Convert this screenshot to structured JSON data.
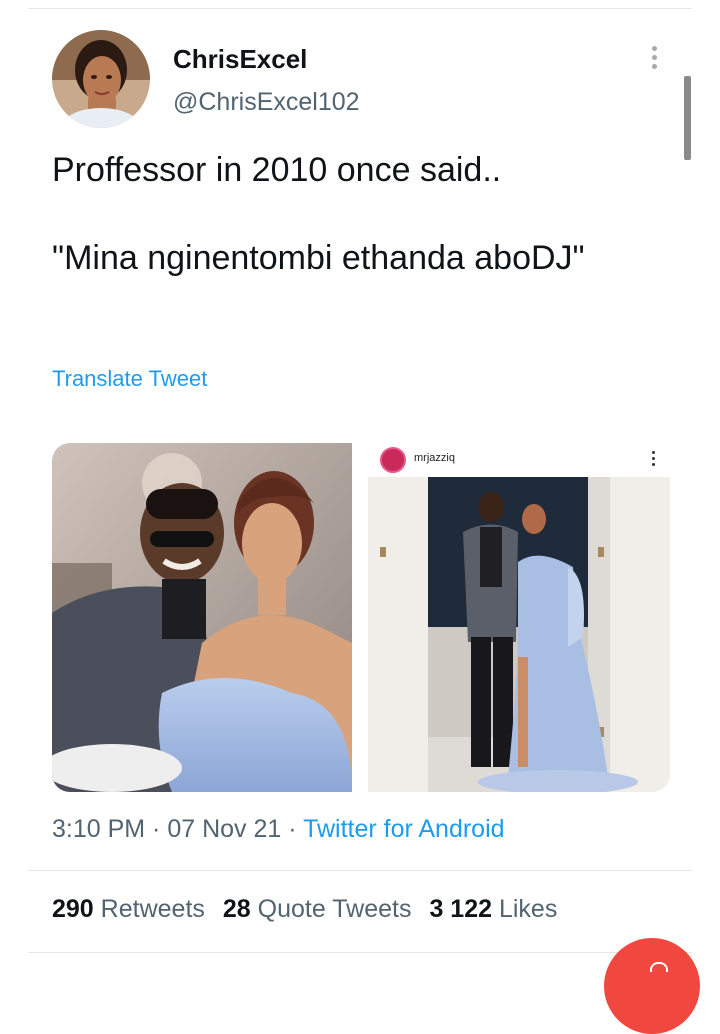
{
  "author": {
    "name": "ChrisExcel",
    "handle": "@ChrisExcel102",
    "avatar_icon": "profile-photo"
  },
  "tweet": {
    "text": "Proffessor in 2010 once said..\n\n\"Mina nginentombi ethanda aboDJ\"",
    "translate_label": "Translate Tweet"
  },
  "media": {
    "ig_username": "mrjazziq"
  },
  "meta": {
    "time": "3:10 PM",
    "separator": " · ",
    "date": "07 Nov 21",
    "source": "Twitter for Android"
  },
  "stats": {
    "retweets_count": "290",
    "retweets_label": "Retweets",
    "quotes_count": "28",
    "quotes_label": "Quote Tweets",
    "likes_count": "3 122",
    "likes_label": "Likes"
  },
  "colors": {
    "accent": "#1d9bf0",
    "fab": "#f0483f"
  }
}
